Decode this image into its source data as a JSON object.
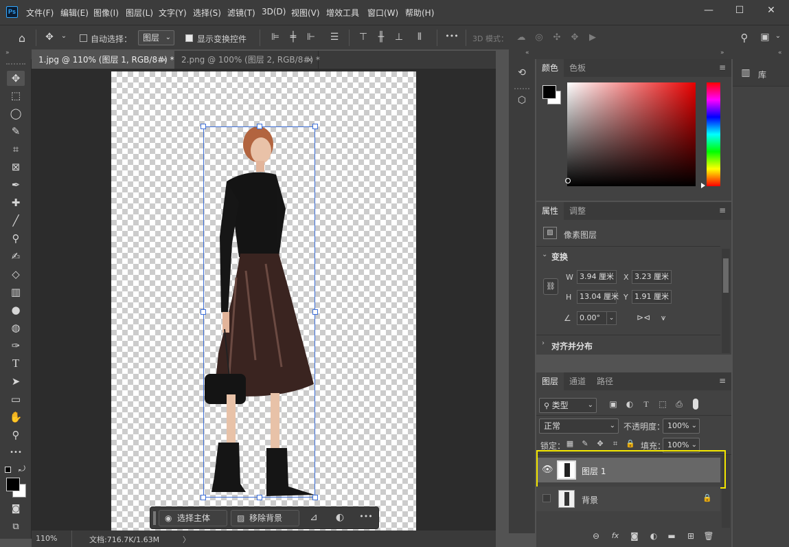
{
  "app": {
    "logo_text": "Ps"
  },
  "menu": [
    "文件(F)",
    "编辑(E)",
    "图像(I)",
    "图层(L)",
    "文字(Y)",
    "选择(S)",
    "滤镜(T)",
    "3D(D)",
    "视图(V)",
    "增效工具",
    "窗口(W)",
    "帮助(H)"
  ],
  "window_controls": {
    "minimize": "—",
    "maximize": "☐",
    "close": "✕"
  },
  "options_bar": {
    "auto_select_label": "自动选择：",
    "auto_select_checked": false,
    "layer_dropdown": "图层",
    "show_transform_label": "显示变换控件",
    "show_transform_checked": true,
    "more_label": "•••",
    "mode_3d_label": "3D 模式："
  },
  "document_tabs": [
    {
      "label": "1.jpg @ 110% (图层 1, RGB/8#) *",
      "active": true,
      "close": "×"
    },
    {
      "label": "2.png @ 100% (图层 2, RGB/8#) *",
      "active": false,
      "close": "×"
    }
  ],
  "tools": [
    "move-tool",
    "marquee-tool",
    "lasso-tool",
    "quick-select-tool",
    "crop-tool",
    "frame-tool",
    "eyedropper-tool",
    "healing-tool",
    "brush-tool",
    "stamp-tool",
    "history-brush-tool",
    "eraser-tool",
    "gradient-tool",
    "blur-tool",
    "dodge-tool",
    "pen-tool",
    "type-tool",
    "path-select-tool",
    "rectangle-tool",
    "hand-tool",
    "zoom-tool",
    "more-tools"
  ],
  "tool_glyphs": [
    "✥",
    "⬚",
    "◯",
    "✎",
    "⌗",
    "⊠",
    "✒",
    "✚",
    "╱",
    "⚲",
    "✍",
    "◇",
    "▥",
    "●",
    "◍",
    "✑",
    "T",
    "➤",
    "▭",
    "✋",
    "⚲",
    "•••"
  ],
  "context_bar": {
    "select_subject": "选择主体",
    "remove_background": "移除背景",
    "more": "•••"
  },
  "status": {
    "zoom": "110%",
    "doc_info": "文档:716.7K/1.63M",
    "arrow": "〉"
  },
  "color_panel": {
    "tabs": [
      "颜色",
      "色板"
    ],
    "active_tab": 0,
    "hue_color": "#e80000"
  },
  "properties_panel": {
    "tabs": [
      "属性",
      "调整"
    ],
    "layer_type": "像素图层",
    "transform_title": "变换",
    "w_label": "W",
    "w_value": "3.94 厘米",
    "h_label": "H",
    "h_value": "13.04 厘米",
    "x_label": "X",
    "x_value": "3.23 厘米",
    "y_label": "Y",
    "y_value": "1.91 厘米",
    "angle_value": "0.00°",
    "align_title": "对齐并分布"
  },
  "layers_panel": {
    "tabs": [
      "图层",
      "通道",
      "路径"
    ],
    "filter_label": "类型",
    "blend_mode": "正常",
    "opacity_label": "不透明度：",
    "opacity_value": "100%",
    "lock_label": "锁定：",
    "fill_label": "填充：",
    "fill_value": "100%",
    "layers": [
      {
        "name": "图层 1",
        "visible": true,
        "selected": true
      },
      {
        "name": "背景",
        "visible": false,
        "selected": false,
        "locked": true
      }
    ],
    "footer_icons": [
      "link-icon",
      "fx-icon",
      "mask-icon",
      "adjustment-icon",
      "group-icon",
      "new-layer-icon",
      "delete-icon"
    ],
    "footer_glyphs": [
      "⊖",
      "fx",
      "◙",
      "◐",
      "▬",
      "⊞",
      "🗑"
    ]
  },
  "library_panel": {
    "label": "库"
  },
  "colors": {
    "accent_highlight": "#f5e800",
    "selection": "#3d6fd8"
  }
}
